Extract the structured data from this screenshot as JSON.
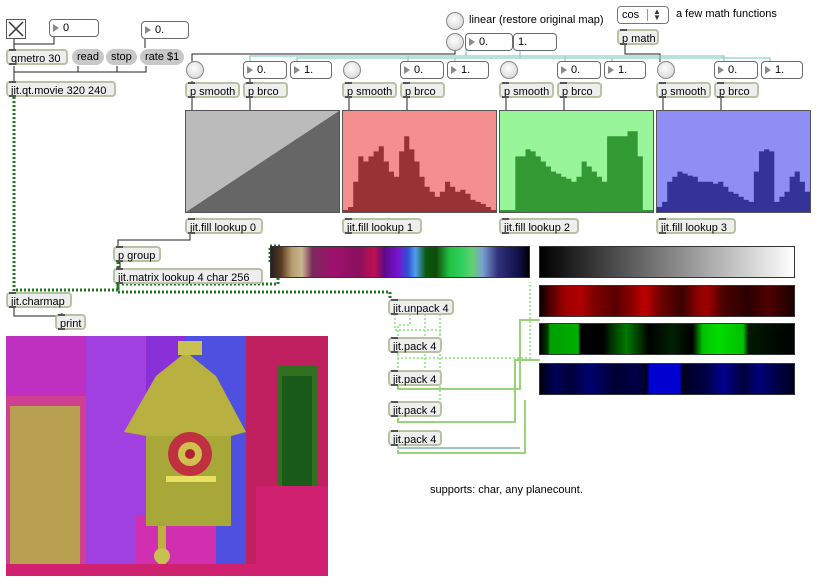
{
  "topbar": {
    "toggle_icon": "x-toggle-icon",
    "number_0": "0",
    "rate_number": "0.",
    "qmetro": "qmetro 30",
    "read": "read",
    "stop": "stop",
    "rate": "rate $1",
    "movie": "jit.qt.movie 320 240"
  },
  "map": {
    "linear_label": "linear (restore original map)",
    "lo": "0.",
    "hi": "1.",
    "func_value": "cos",
    "func_label": "a few math functions",
    "pmath": "p math"
  },
  "channels": [
    {
      "smooth": "p smooth",
      "brco": "p brco",
      "lo": "0.",
      "hi": "1.",
      "fill": "jit.fill lookup 0",
      "color": "#666666",
      "bg": "#bbbbbb"
    },
    {
      "smooth": "p smooth",
      "brco": "p brco",
      "lo": "0.",
      "hi": "1.",
      "fill": "jit.fill lookup 1",
      "color": "#993333",
      "bg": "#f58e8e"
    },
    {
      "smooth": "p smooth",
      "brco": "p brco",
      "lo": "0.",
      "hi": "1.",
      "fill": "jit.fill lookup 2",
      "color": "#339933",
      "bg": "#99f599"
    },
    {
      "smooth": "p smooth",
      "brco": "p brco",
      "lo": "0.",
      "hi": "1.",
      "fill": "jit.fill lookup 3",
      "color": "#333399",
      "bg": "#8e8ef5"
    }
  ],
  "middle": {
    "pgroup": "p group",
    "lookup": "jit.matrix lookup 4 char 256",
    "charmap": "jit.charmap",
    "print": "print",
    "unpack": "jit.unpack 4",
    "pack": "jit.pack 4"
  },
  "supports": "supports: char, any planecount.",
  "colors": {
    "wire_green": "#1f7a1f",
    "wire_cyan": "#8fd0c8",
    "box_border": "#b7c3a2"
  }
}
